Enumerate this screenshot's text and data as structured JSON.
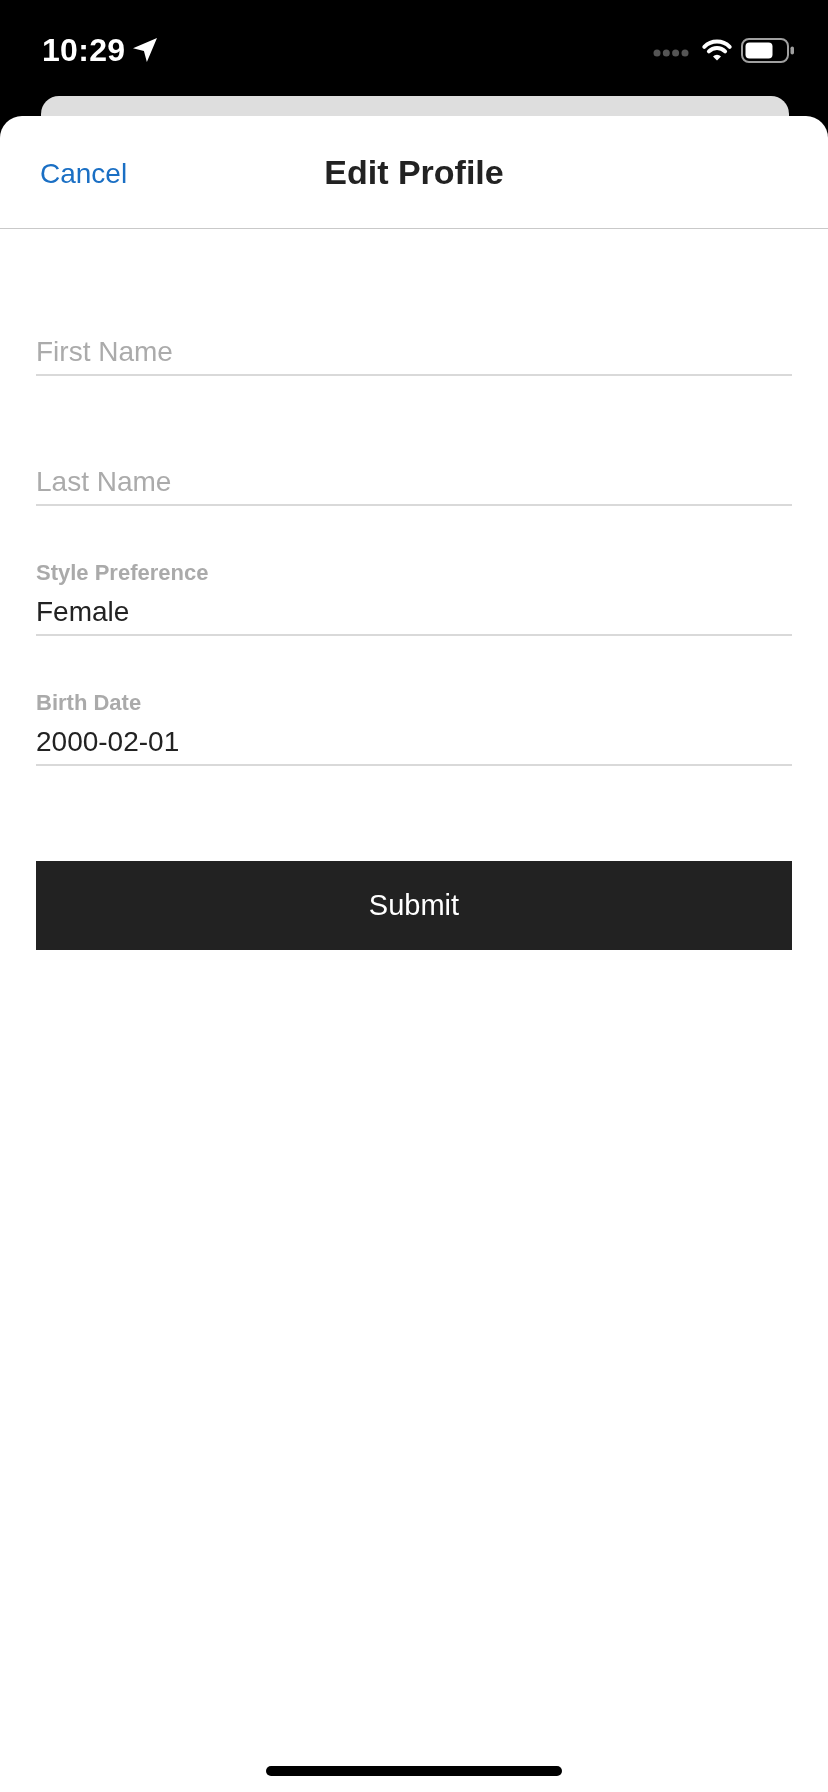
{
  "status_bar": {
    "time": "10:29"
  },
  "nav": {
    "cancel": "Cancel",
    "title": "Edit Profile"
  },
  "form": {
    "fields": [
      {
        "kind": "empty",
        "placeholder": "First Name"
      },
      {
        "kind": "empty",
        "placeholder": "Last Name"
      },
      {
        "kind": "filled",
        "label": "Style Preference",
        "value": "Female"
      },
      {
        "kind": "filled",
        "label": "Birth Date",
        "value": "2000-02-01"
      }
    ],
    "submit": "Submit"
  }
}
